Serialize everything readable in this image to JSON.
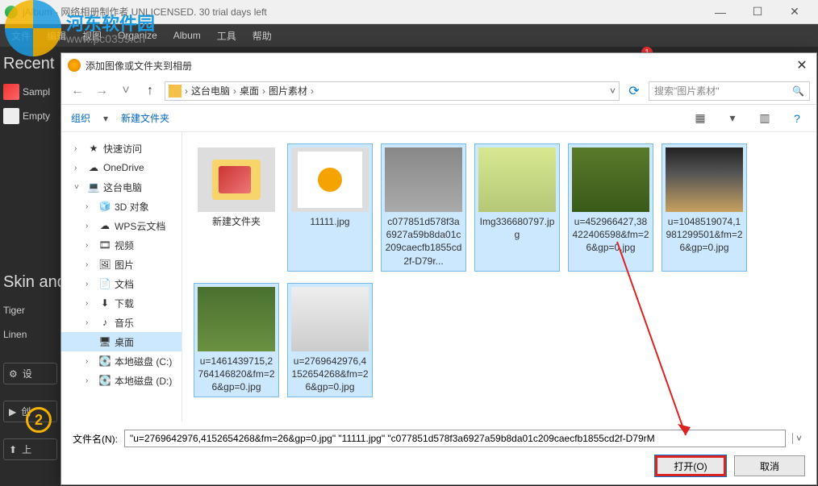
{
  "app": {
    "title": "jAlbum - 网络相册制作者 UNLICENSED. 30 trial days left",
    "menubar": [
      "文件",
      "编辑",
      "视图",
      "Organize",
      "Album",
      "工具",
      "帮助"
    ],
    "recent_label": "Recent",
    "items": [
      {
        "label": "Sampl"
      },
      {
        "label": "Empty"
      }
    ],
    "skin_label": "Skin and",
    "skins": [
      "Tiger",
      "Linen"
    ],
    "settings_btn": "设",
    "build_btn": "创",
    "upload_btn": "上",
    "badge_num": "2",
    "red_dot": "1"
  },
  "watermark": {
    "name": "河东软件园",
    "url": "www.pc0359.cn"
  },
  "dialog": {
    "title": "添加图像或文件夹到相册",
    "breadcrumb": [
      "这台电脑",
      "桌面",
      "图片素材"
    ],
    "search_placeholder": "搜索\"图片素材\"",
    "toolbar": {
      "organize": "组织",
      "new_folder": "新建文件夹"
    },
    "tree": [
      {
        "label": "快速访问",
        "icon": "star",
        "level": 1,
        "expand": ">"
      },
      {
        "label": "OneDrive",
        "icon": "cloud",
        "level": 1,
        "expand": ">"
      },
      {
        "label": "这台电脑",
        "icon": "pc",
        "level": 1,
        "expand": "v"
      },
      {
        "label": "3D 对象",
        "icon": "cube",
        "level": 2,
        "expand": ">"
      },
      {
        "label": "WPS云文档",
        "icon": "wps",
        "level": 2,
        "expand": ">"
      },
      {
        "label": "视频",
        "icon": "video",
        "level": 2,
        "expand": ">"
      },
      {
        "label": "图片",
        "icon": "image",
        "level": 2,
        "expand": ">"
      },
      {
        "label": "文档",
        "icon": "doc",
        "level": 2,
        "expand": ">"
      },
      {
        "label": "下载",
        "icon": "download",
        "level": 2,
        "expand": ">"
      },
      {
        "label": "音乐",
        "icon": "music",
        "level": 2,
        "expand": ">"
      },
      {
        "label": "桌面",
        "icon": "desktop",
        "level": 2,
        "expand": "",
        "selected": true
      },
      {
        "label": "本地磁盘 (C:)",
        "icon": "disk",
        "level": 2,
        "expand": ">"
      },
      {
        "label": "本地磁盘 (D:)",
        "icon": "disk",
        "level": 2,
        "expand": ">"
      }
    ],
    "files": [
      {
        "name": "新建文件夹",
        "thumb": "folder",
        "selected": false
      },
      {
        "name": "11111.jpg",
        "thumb": "sun",
        "selected": true
      },
      {
        "name": "c077851d578f3a6927a59b8da01c209caecfb1855cd2f-D79r...",
        "thumb": "cat",
        "selected": true
      },
      {
        "name": "Img336680797.jpg",
        "thumb": "duck",
        "selected": true
      },
      {
        "name": "u=452966427,38422406598&fm=26&gp=0.jpg",
        "thumb": "squirrel",
        "selected": true
      },
      {
        "name": "u=1048519074,1981299501&fm=26&gp=0.jpg",
        "thumb": "cheetah",
        "selected": true
      },
      {
        "name": "u=1461439715,2764146820&fm=26&gp=0.jpg",
        "thumb": "bird",
        "selected": true
      },
      {
        "name": "u=2769642976,4152654268&fm=26&gp=0.jpg",
        "thumb": "kittens",
        "selected": true
      }
    ],
    "filename_label": "文件名(N):",
    "filename_value": "\"u=2769642976,4152654268&fm=26&gp=0.jpg\" \"11111.jpg\" \"c077851d578f3a6927a59b8da01c209caecfb1855cd2f-D79rM",
    "open_btn": "打开(O)",
    "cancel_btn": "取消"
  }
}
